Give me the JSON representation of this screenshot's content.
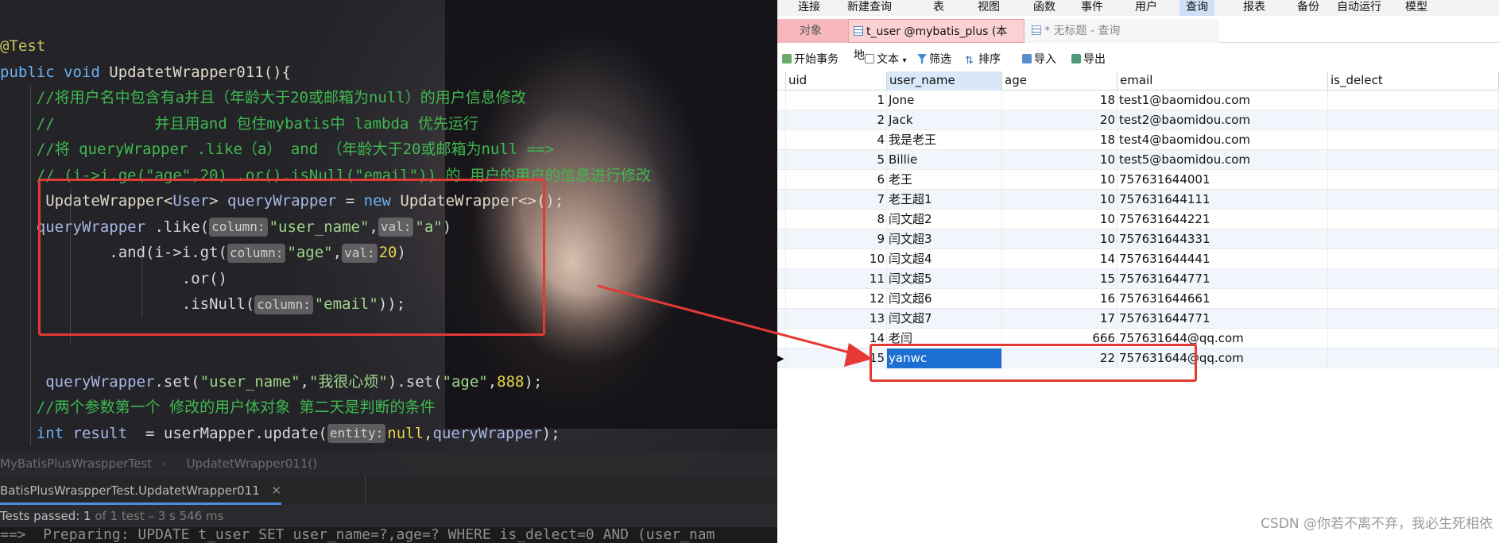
{
  "ide": {
    "code_lines": [
      {
        "parts": [
          {
            "c": "an",
            "t": "@Test"
          }
        ]
      },
      {
        "parts": [
          {
            "c": "kw",
            "t": "public void "
          },
          {
            "c": "fn",
            "t": "UpdatetWrapper011(){"
          }
        ]
      },
      {
        "parts": [
          {
            "c": "",
            "t": "    "
          },
          {
            "c": "cm",
            "t": "//将用户名中包含有a并且（年龄大于20或邮箱为null）的用户信息修改"
          }
        ]
      },
      {
        "parts": [
          {
            "c": "",
            "t": "    "
          },
          {
            "c": "cm",
            "t": "//           并且用and 包住mybatis中 lambda 优先运行"
          }
        ]
      },
      {
        "parts": [
          {
            "c": "",
            "t": "    "
          },
          {
            "c": "cm",
            "t": "//将 queryWrapper .like（a） and （年龄大于20或邮箱为null ==>"
          }
        ]
      },
      {
        "parts": [
          {
            "c": "",
            "t": "    "
          },
          {
            "c": "cm",
            "t": "// (i->i.ge(\"age\",20) .or().isNull(\"email\")) 的 用户的用户的信息进行修改"
          }
        ]
      },
      {
        "parts": [
          {
            "c": "",
            "t": "     "
          },
          {
            "c": "fn",
            "t": "UpdateWrapper<"
          },
          {
            "c": "var",
            "t": "User"
          },
          {
            "c": "fn",
            "t": "> "
          },
          {
            "c": "var",
            "t": "queryWrapper"
          },
          {
            "c": "",
            "t": " = "
          },
          {
            "c": "kw",
            "t": "new "
          },
          {
            "c": "fn",
            "t": "UpdateWrapper<>();"
          }
        ]
      },
      {
        "parts": [
          {
            "c": "",
            "t": "    "
          },
          {
            "c": "var",
            "t": "queryWrapper"
          },
          {
            "c": "",
            "t": " .like("
          },
          {
            "c": "hint",
            "t": "column:"
          },
          {
            "c": "str",
            "t": "\"user_name\""
          },
          {
            "c": "",
            "t": ","
          },
          {
            "c": "hint",
            "t": "val:"
          },
          {
            "c": "str",
            "t": "\"a\""
          },
          {
            "c": "",
            "t": ")"
          }
        ]
      },
      {
        "parts": [
          {
            "c": "",
            "t": "            .and(i->i.gt("
          },
          {
            "c": "hint",
            "t": "column:"
          },
          {
            "c": "str",
            "t": "\"age\""
          },
          {
            "c": "",
            "t": ","
          },
          {
            "c": "hint",
            "t": "val:"
          },
          {
            "c": "num",
            "t": "20"
          },
          {
            "c": "",
            "t": ")"
          }
        ]
      },
      {
        "parts": [
          {
            "c": "",
            "t": "                    .or()"
          }
        ]
      },
      {
        "parts": [
          {
            "c": "",
            "t": "                    .isNull("
          },
          {
            "c": "hint",
            "t": "column:"
          },
          {
            "c": "str",
            "t": "\"email\""
          },
          {
            "c": "",
            "t": "));"
          }
        ]
      },
      {
        "parts": []
      },
      {
        "parts": []
      },
      {
        "parts": [
          {
            "c": "",
            "t": "     "
          },
          {
            "c": "var",
            "t": "queryWrapper"
          },
          {
            "c": "",
            "t": ".set("
          },
          {
            "c": "str",
            "t": "\"user_name\""
          },
          {
            "c": "",
            "t": ","
          },
          {
            "c": "str",
            "t": "\"我很心烦\""
          },
          {
            "c": "",
            "t": ").set("
          },
          {
            "c": "str",
            "t": "\"age\""
          },
          {
            "c": "",
            "t": ","
          },
          {
            "c": "num",
            "t": "888"
          },
          {
            "c": "",
            "t": ");"
          }
        ]
      },
      {
        "parts": [
          {
            "c": "",
            "t": "    "
          },
          {
            "c": "cm",
            "t": "//两个参数第一个 修改的用户体对象 第二天是判断的条件"
          }
        ]
      },
      {
        "parts": [
          {
            "c": "",
            "t": "    "
          },
          {
            "c": "kw",
            "t": "int "
          },
          {
            "c": "var",
            "t": "result"
          },
          {
            "c": "",
            "t": "  = userMapper.update("
          },
          {
            "c": "hint",
            "t": "entity:"
          },
          {
            "c": "num",
            "t": "null"
          },
          {
            "c": "",
            "t": ","
          },
          {
            "c": "var",
            "t": "queryWrapper"
          },
          {
            "c": "",
            "t": ");"
          }
        ]
      }
    ],
    "breadcrumb_left": "MyBatisPlusWraspperTest",
    "breadcrumb_right": "UpdatetWrapper011()",
    "run_tab": "BatisPlusWraspperTest.UpdatetWrapper011",
    "status_prefix": "Tests passed: ",
    "status_count": "1",
    "status_suffix": " of 1 test – 3 s 546 ms",
    "sql_line": "==>  Preparing: UPDATE t_user SET user_name=?,age=? WHERE is_delect=0 AND (user_nam"
  },
  "navicat": {
    "menu": [
      "连接",
      "新建查询",
      "表",
      "视图",
      "函数",
      "事件",
      "用户",
      "查询",
      "报表",
      "备份",
      "自动运行",
      "模型"
    ],
    "menu_active": "查询",
    "tabs": {
      "objects": "对象",
      "table_tab": "t_user @mybatis_plus (本地...",
      "query_tab": "* 无标题 - 查询"
    },
    "toolbar": {
      "begin_tx": "开始事务",
      "text": "文本",
      "filter": "筛选",
      "sort": "排序",
      "import": "导入",
      "export": "导出"
    },
    "columns": [
      "uid",
      "user_name",
      "age",
      "email",
      "is_delect"
    ],
    "rows": [
      [
        "1",
        "Jone",
        "18",
        "test1@baomidou.com"
      ],
      [
        "2",
        "Jack",
        "20",
        "test2@baomidou.com"
      ],
      [
        "4",
        "我是老王",
        "18",
        "test4@baomidou.com"
      ],
      [
        "5",
        "Billie",
        "10",
        "test5@baomidou.com"
      ],
      [
        "6",
        "老王",
        "10",
        "757631644001"
      ],
      [
        "7",
        "老王超1",
        "10",
        "757631644111"
      ],
      [
        "8",
        "闫文超2",
        "10",
        "757631644221"
      ],
      [
        "9",
        "闫文超3",
        "10",
        "757631644331"
      ],
      [
        "10",
        "闫文超4",
        "14",
        "757631644441"
      ],
      [
        "11",
        "闫文超5",
        "15",
        "757631644771"
      ],
      [
        "12",
        "闫文超6",
        "16",
        "757631644661"
      ],
      [
        "13",
        "闫文超7",
        "17",
        "757631644771"
      ],
      [
        "14",
        "老闫",
        "666",
        "757631644@qq.com"
      ],
      [
        "15",
        "yanwc",
        "22",
        "757631644@qq.com"
      ]
    ],
    "watermark": "CSDN @你若不离不弃，我必生死相依"
  }
}
